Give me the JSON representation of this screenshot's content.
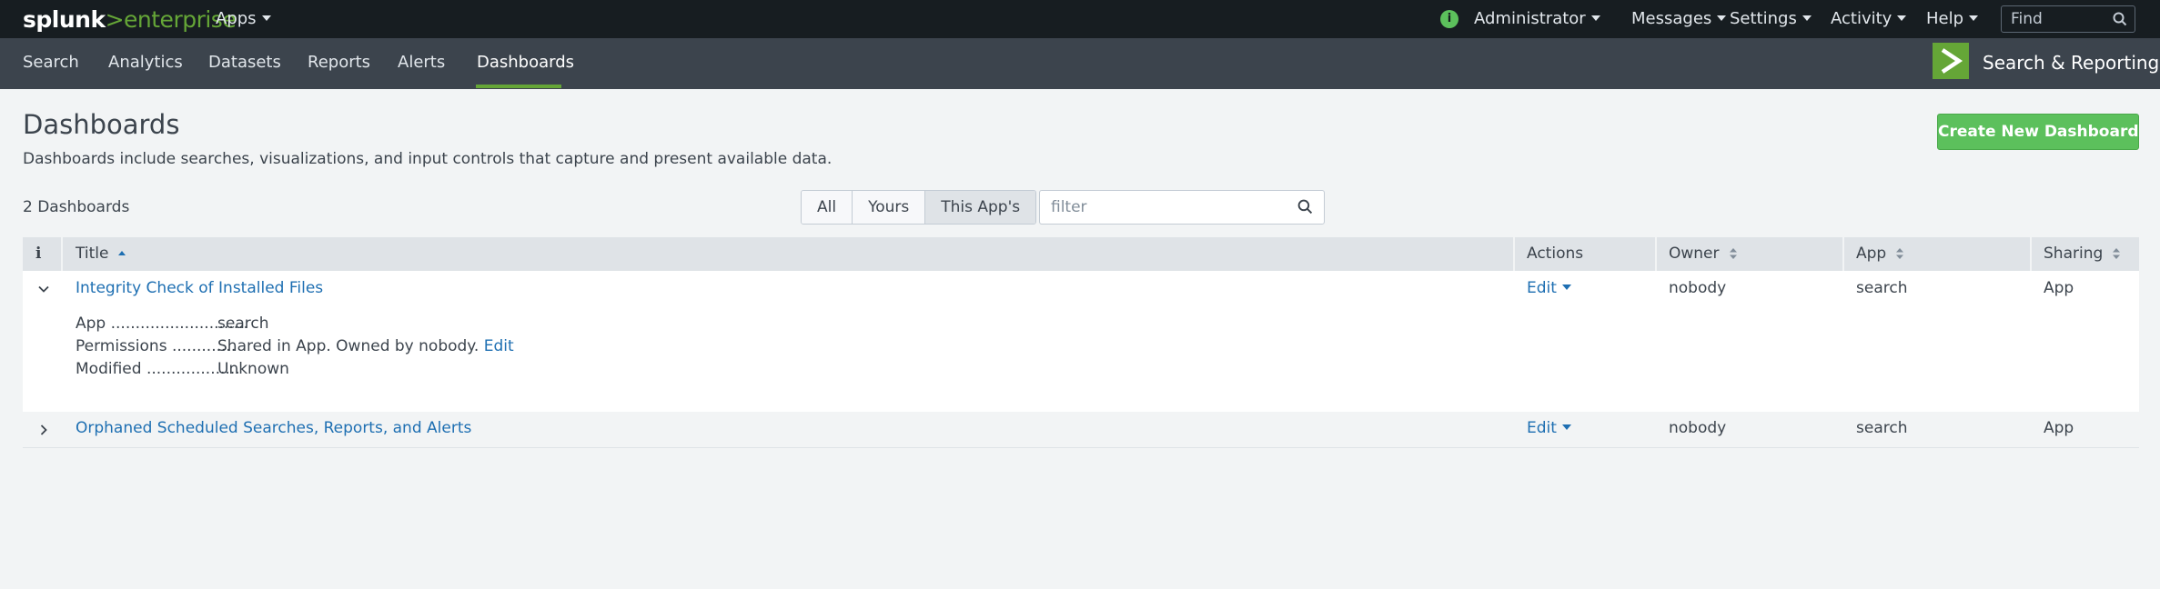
{
  "topbar": {
    "logo_word": "splunk",
    "logo_gt": ">",
    "logo_product": "enterprise",
    "apps_label": "Apps",
    "user_label": "Administrator",
    "messages_label": "Messages",
    "settings_label": "Settings",
    "activity_label": "Activity",
    "help_label": "Help",
    "find_placeholder": "Find",
    "info_glyph": "i"
  },
  "appbar": {
    "nav": [
      "Search",
      "Analytics",
      "Datasets",
      "Reports",
      "Alerts",
      "Dashboards"
    ],
    "active": "Dashboards",
    "app_title": "Search & Reporting"
  },
  "page": {
    "title": "Dashboards",
    "description": "Dashboards include searches, visualizations, and input controls that capture and present available data.",
    "create_button": "Create New Dashboard",
    "count_label": "2 Dashboards",
    "filter_options": [
      "All",
      "Yours",
      "This App's"
    ],
    "filter_selected": "This App's",
    "filter_placeholder": "filter"
  },
  "table": {
    "info_header": "i",
    "columns": [
      "Title",
      "Actions",
      "Owner",
      "App",
      "Sharing"
    ],
    "sorted_by": "Title",
    "rows": [
      {
        "title": "Integrity Check of Installed Files",
        "expanded": true,
        "action": "Edit",
        "owner": "nobody",
        "app": "search",
        "sharing": "App",
        "details": {
          "app_label": "App",
          "app_dots": "............................",
          "app_value": "search",
          "permissions_label": "Permissions",
          "permissions_dots": ".............",
          "permissions_value": "Shared in App. Owned by nobody.",
          "permissions_link": "Edit",
          "modified_label": "Modified",
          "modified_dots": "...................",
          "modified_value": "Unknown"
        }
      },
      {
        "title": "Orphaned Scheduled Searches, Reports, and Alerts",
        "expanded": false,
        "action": "Edit",
        "owner": "nobody",
        "app": "search",
        "sharing": "App"
      }
    ]
  },
  "colors": {
    "topbar": "#171d21",
    "appbar": "#3c444d",
    "accent_green": "#65a637",
    "button_green": "#5cc05c",
    "link_blue": "#1e6fb2"
  }
}
